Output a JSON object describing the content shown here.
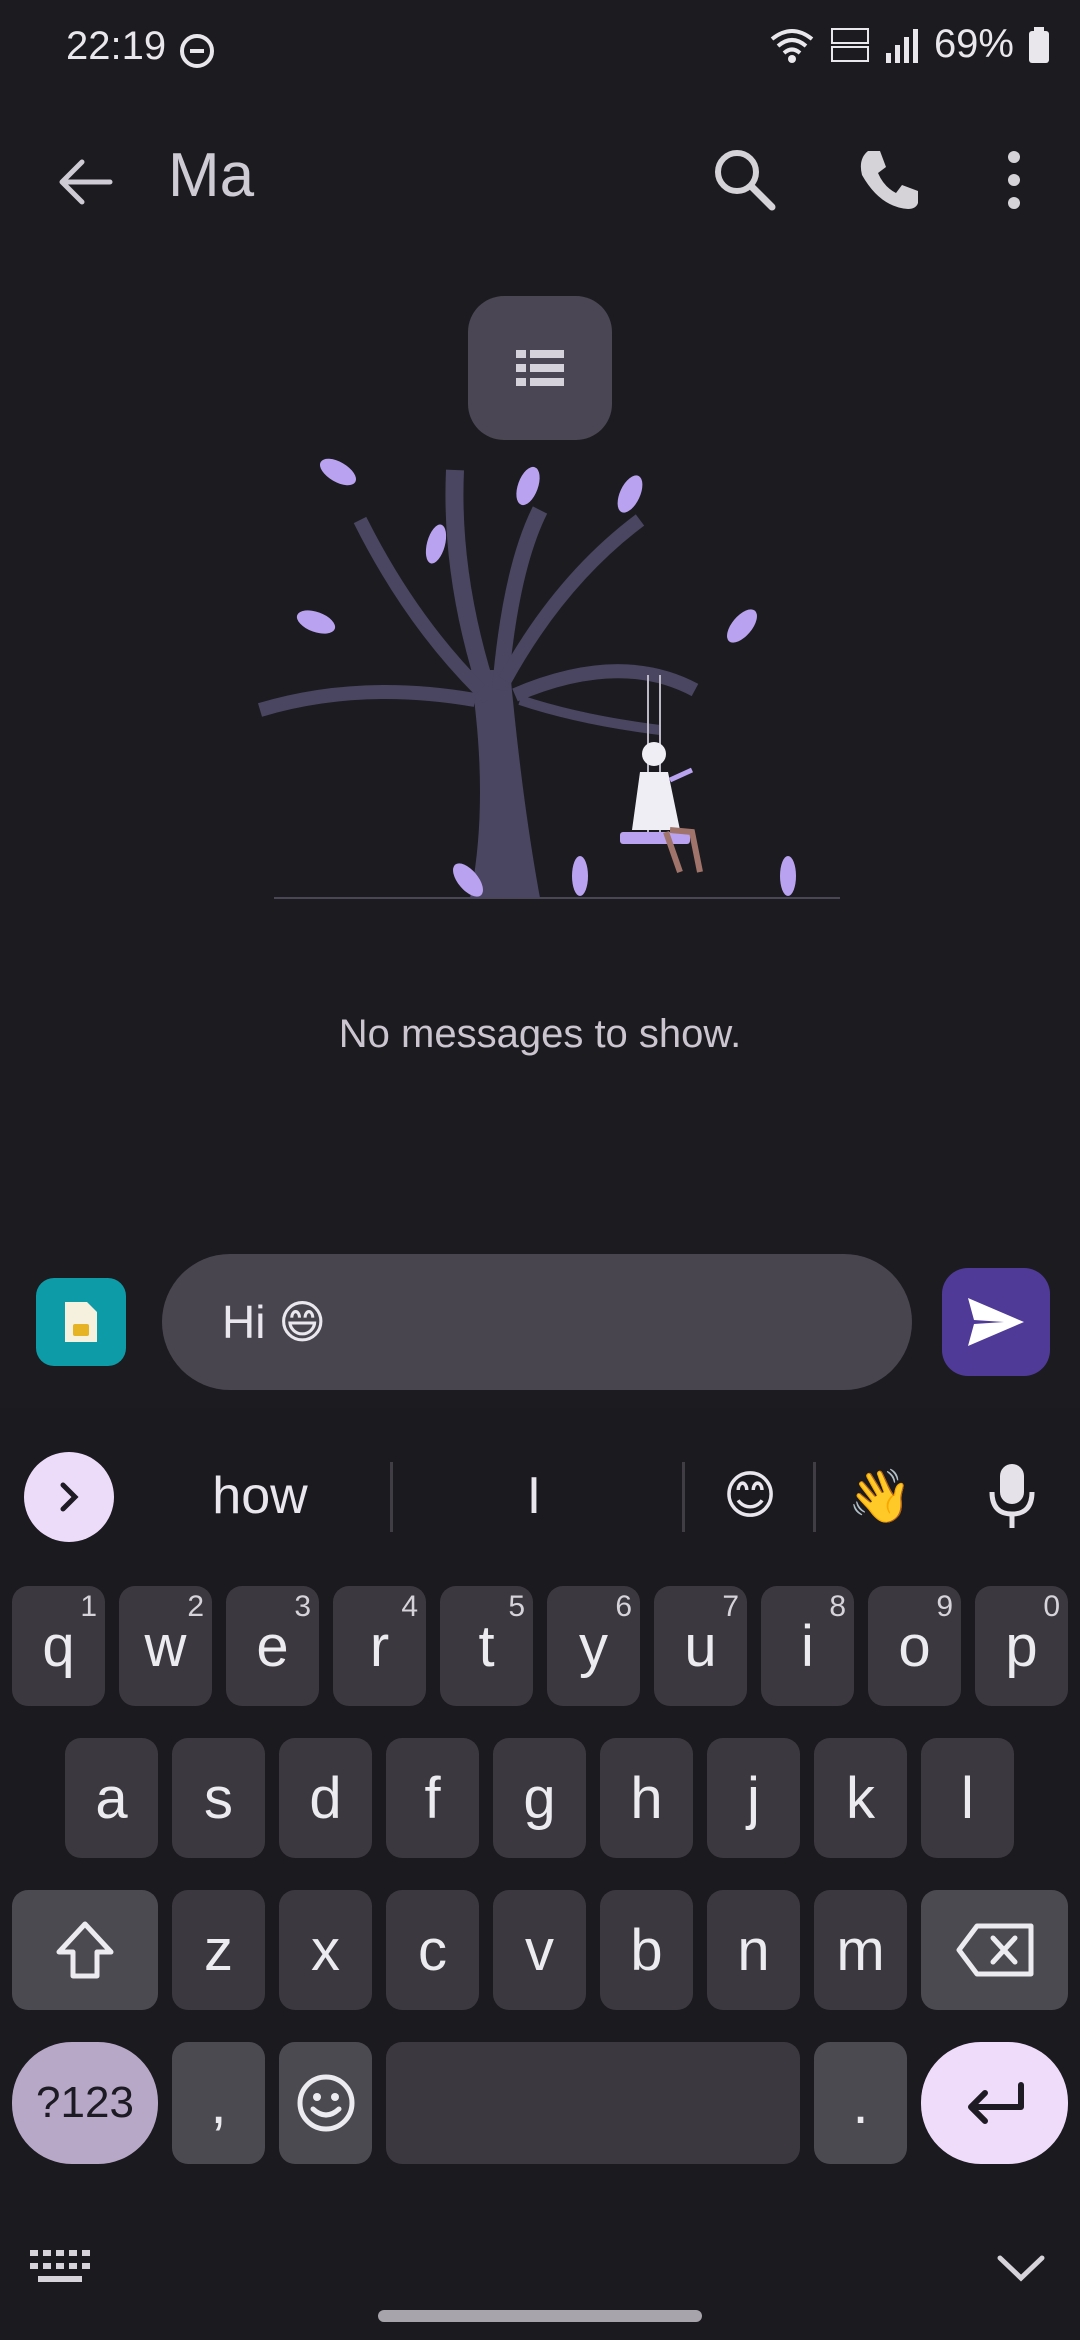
{
  "status_bar": {
    "time": "22:19",
    "battery": "69%"
  },
  "app_bar": {
    "title": "Ma"
  },
  "empty_state": {
    "message": "No messages to show."
  },
  "compose": {
    "value": "Hi 😄"
  },
  "keyboard": {
    "suggestions": [
      "how",
      "I",
      "😊",
      "👋"
    ],
    "row1": [
      {
        "label": "q",
        "hint": "1"
      },
      {
        "label": "w",
        "hint": "2"
      },
      {
        "label": "e",
        "hint": "3"
      },
      {
        "label": "r",
        "hint": "4"
      },
      {
        "label": "t",
        "hint": "5"
      },
      {
        "label": "y",
        "hint": "6"
      },
      {
        "label": "u",
        "hint": "7"
      },
      {
        "label": "i",
        "hint": "8"
      },
      {
        "label": "o",
        "hint": "9"
      },
      {
        "label": "p",
        "hint": "0"
      }
    ],
    "row2": [
      "a",
      "s",
      "d",
      "f",
      "g",
      "h",
      "j",
      "k",
      "l"
    ],
    "row3": [
      "z",
      "x",
      "c",
      "v",
      "b",
      "n",
      "m"
    ],
    "symbols_label": "?123",
    "comma_label": ",",
    "period_label": "."
  },
  "colors": {
    "accent": "#4f3a97",
    "sim": "#0d9ba8",
    "leaf": "#b9a3f0",
    "tree": "#4a4560"
  },
  "icons": [
    "dnd-icon",
    "wifi-icon",
    "volte-icon",
    "signal-icon",
    "battery-icon",
    "back-arrow-icon",
    "search-icon",
    "phone-icon",
    "more-vert-icon",
    "list-icon",
    "sim-card-icon",
    "send-icon",
    "chevron-right-icon",
    "mic-icon",
    "shift-icon",
    "backspace-icon",
    "emoji-icon",
    "enter-icon",
    "keyboard-icon",
    "chevron-down-icon"
  ]
}
